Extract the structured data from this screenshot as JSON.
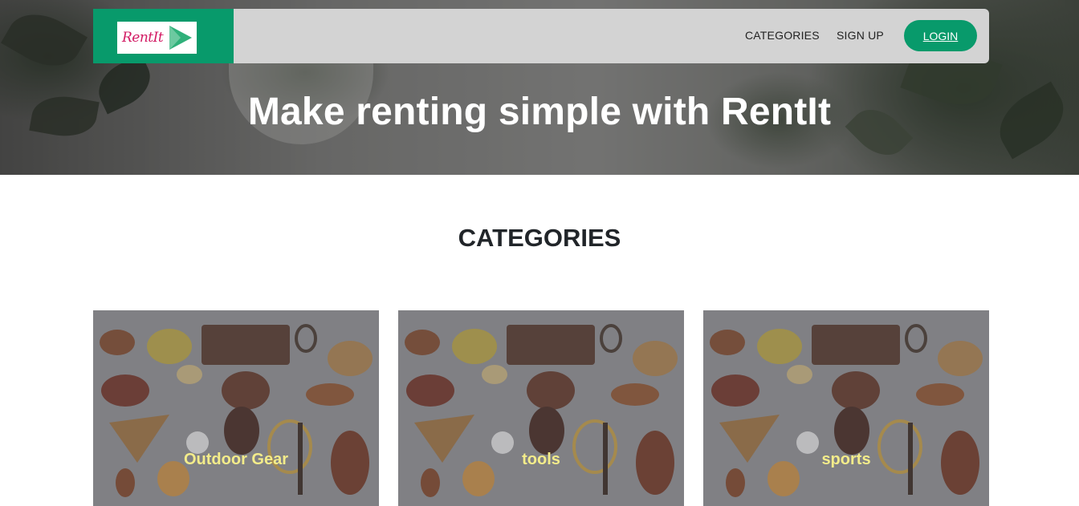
{
  "brand": {
    "logo_text": "RentIt",
    "logo_icon": "play-triangle-icon"
  },
  "nav": {
    "categories_label": "CATEGORIES",
    "signup_label": "SIGN UP",
    "login_label": "LOGIN"
  },
  "hero": {
    "title": "Make renting simple with RentIt"
  },
  "categories": {
    "heading": "CATEGORIES",
    "items": [
      {
        "label": "Outdoor Gear"
      },
      {
        "label": "tools"
      },
      {
        "label": "sports"
      }
    ]
  },
  "colors": {
    "brand_green": "#089a6b",
    "navbar_bg": "#d3d3d3",
    "logo_pink": "#d21a63",
    "card_label": "#f3ec8a"
  }
}
